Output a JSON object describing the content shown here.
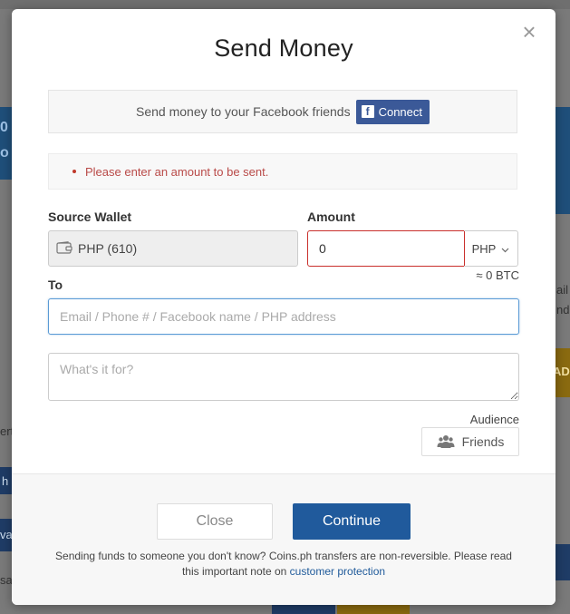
{
  "modal": {
    "title": "Send Money",
    "close_icon": "close-icon"
  },
  "facebook": {
    "text": "Send money to your Facebook friends",
    "button_label": "Connect",
    "icon_letter": "f"
  },
  "error": {
    "message": "Please enter an amount to be sent."
  },
  "source_wallet": {
    "label": "Source Wallet",
    "value": "PHP (610)",
    "icon": "wallet-icon"
  },
  "amount": {
    "label": "Amount",
    "value": "0",
    "currency": "PHP",
    "btc_equivalent": "≈ 0 BTC"
  },
  "to": {
    "label": "To",
    "placeholder": "Email / Phone # / Facebook name / PHP address"
  },
  "note": {
    "placeholder": "What's it for?"
  },
  "audience": {
    "label": "Audience",
    "button_label": "Friends",
    "icon": "friends-icon"
  },
  "footer": {
    "close_label": "Close",
    "continue_label": "Continue",
    "note_text": "Sending funds to someone you don't know? Coins.ph transfers are non-reversible. Please read this important note on ",
    "link_text": "customer protection"
  },
  "background": {
    "frag_1": "0",
    "frag_2": "o",
    "frag_3": "ail",
    "frag_4": "nd",
    "frag_5": "AD",
    "frag_6": "ert",
    "frag_7": "h",
    "frag_8": "va",
    "frag_9": "sa"
  },
  "colors": {
    "primary": "#205a9c",
    "facebook": "#3b5998",
    "error": "#b94a48",
    "input_focus": "#5b9bd5"
  }
}
